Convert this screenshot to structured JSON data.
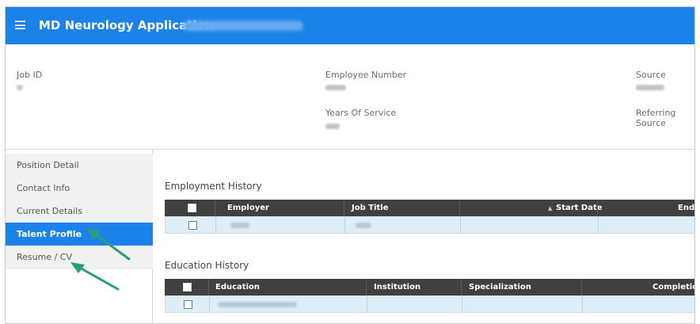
{
  "header": {
    "app_title": "MD Neurology Application",
    "menu_icon": "hamburger-menu-icon"
  },
  "info_panel": {
    "job_id_label": "Job ID",
    "employee_number_label": "Employee Number",
    "years_of_service_label": "Years Of Service",
    "source_label": "Source",
    "referring_source_label": "Referring Source"
  },
  "sidebar": {
    "items": [
      {
        "label": "Position Detail"
      },
      {
        "label": "Contact Info"
      },
      {
        "label": "Current Details"
      },
      {
        "label": "Talent Profile"
      },
      {
        "label": "Resume / CV"
      }
    ],
    "active_item": "Talent Profile"
  },
  "employment_history": {
    "title": "Employment History",
    "columns": [
      "Employer",
      "Job Title",
      "Start Date",
      "End D"
    ]
  },
  "education_history": {
    "title": "Education History",
    "columns": [
      "Education",
      "Institution",
      "Specialization",
      "Completion Dat"
    ]
  },
  "colors": {
    "accent": "#1a82e8",
    "table_header": "#404040",
    "row_background": "#ddeef6",
    "annotation_arrow": "#2a9d7a"
  }
}
